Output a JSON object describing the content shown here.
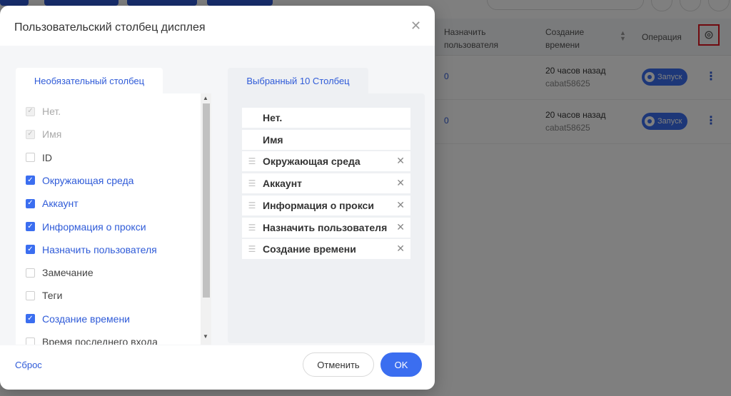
{
  "background": {
    "table": {
      "headers": {
        "assign_user": "Назначить пользователя",
        "created_time": "Создание времени",
        "operation": "Операция"
      },
      "rows": [
        {
          "assign_count": "0",
          "time": "20 часов назад",
          "user": "cabat58625",
          "launch": "Запуск"
        },
        {
          "assign_count": "0",
          "time": "20 часов назад",
          "user": "cabat58625",
          "launch": "Запуск"
        }
      ]
    }
  },
  "modal": {
    "title": "Пользовательский столбец дисплея",
    "optional_tab": "Необязательный столбец",
    "selected_tab": "Выбранный 10 Столбец",
    "options": [
      {
        "label": "Нет.",
        "state": "disabled"
      },
      {
        "label": "Имя",
        "state": "disabled"
      },
      {
        "label": "ID",
        "state": "unchecked"
      },
      {
        "label": "Окружающая среда",
        "state": "checked"
      },
      {
        "label": "Аккаунт",
        "state": "checked"
      },
      {
        "label": "Информация о прокси",
        "state": "checked"
      },
      {
        "label": "Назначить пользователя",
        "state": "checked"
      },
      {
        "label": "Замечание",
        "state": "unchecked"
      },
      {
        "label": "Теги",
        "state": "unchecked"
      },
      {
        "label": "Создание времени",
        "state": "checked"
      },
      {
        "label": "Время последнего входа",
        "state": "unchecked"
      }
    ],
    "selected": [
      {
        "label": "Нет.",
        "fixed": true
      },
      {
        "label": "Имя",
        "fixed": true
      },
      {
        "label": "Окружающая среда",
        "fixed": false
      },
      {
        "label": "Аккаунт",
        "fixed": false
      },
      {
        "label": "Информация о прокси",
        "fixed": false
      },
      {
        "label": "Назначить пользователя",
        "fixed": false
      },
      {
        "label": "Создание времени",
        "fixed": false
      }
    ],
    "reset_label": "Сброс",
    "cancel_label": "Отменить",
    "ok_label": "OK"
  },
  "colors": {
    "accent": "#3b6ef0",
    "highlight_border": "#e0141e"
  }
}
